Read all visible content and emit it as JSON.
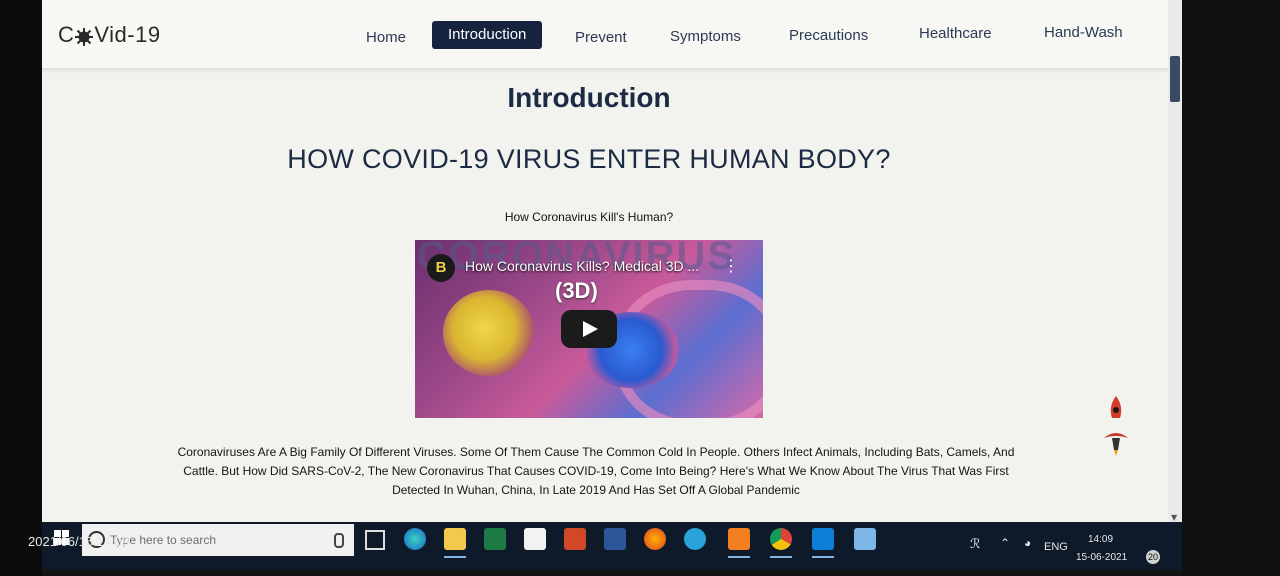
{
  "brand": {
    "prefix": "C",
    "suffix": "Vid-19"
  },
  "nav": {
    "items": [
      {
        "label": "Home",
        "active": false
      },
      {
        "label": "Introduction",
        "active": true
      },
      {
        "label": "Prevent",
        "active": false
      },
      {
        "label": "Symptoms",
        "active": false
      },
      {
        "label": "Precautions",
        "active": false
      },
      {
        "label": "Healthcare",
        "active": false
      },
      {
        "label": "Hand-Wash",
        "active": false
      }
    ]
  },
  "main": {
    "page_title": "Introduction",
    "headline": "HOW COVID-19 VIRUS ENTER HUMAN BODY?",
    "subhead": "How Coronavirus Kill's Human?",
    "video": {
      "background_word": "CORONAVIRUS",
      "channel_badge": "B",
      "title": "How Coronavirus Kills? Medical 3D ...",
      "tag": "(3D)"
    },
    "paragraph": "Coronaviruses Are A Big Family Of Different Viruses. Some Of Them Cause The Common Cold In People. Others Infect Animals, Including Bats, Camels, And Cattle. But How Did SARS-CoV-2, The New Coronavirus That Causes COVID-19, Come Into Being? Here's What We Know About The Virus That Was First Detected In Wuhan, China, In Late 2019 And Has Set Off A Global Pandemic"
  },
  "taskbar": {
    "search_placeholder": "Type here to search",
    "icons": [
      "task-view-icon",
      "edge-icon",
      "file-explorer-icon",
      "excel-icon",
      "store-icon",
      "powerpoint-icon",
      "word-icon",
      "firefox-icon",
      "telegram-icon",
      "xampp-icon",
      "chrome-icon",
      "vscode-icon",
      "notepad-icon"
    ],
    "tray": {
      "language": "ENG",
      "time": "14:09",
      "date": "15-06-2021",
      "notifications": "20"
    }
  },
  "photo_timestamp": "2021/06/15 14:09",
  "colors": {
    "nav_active_bg": "#15233f",
    "text_dark": "#1d2a44",
    "taskbar_bg": "#0e1a2a"
  }
}
